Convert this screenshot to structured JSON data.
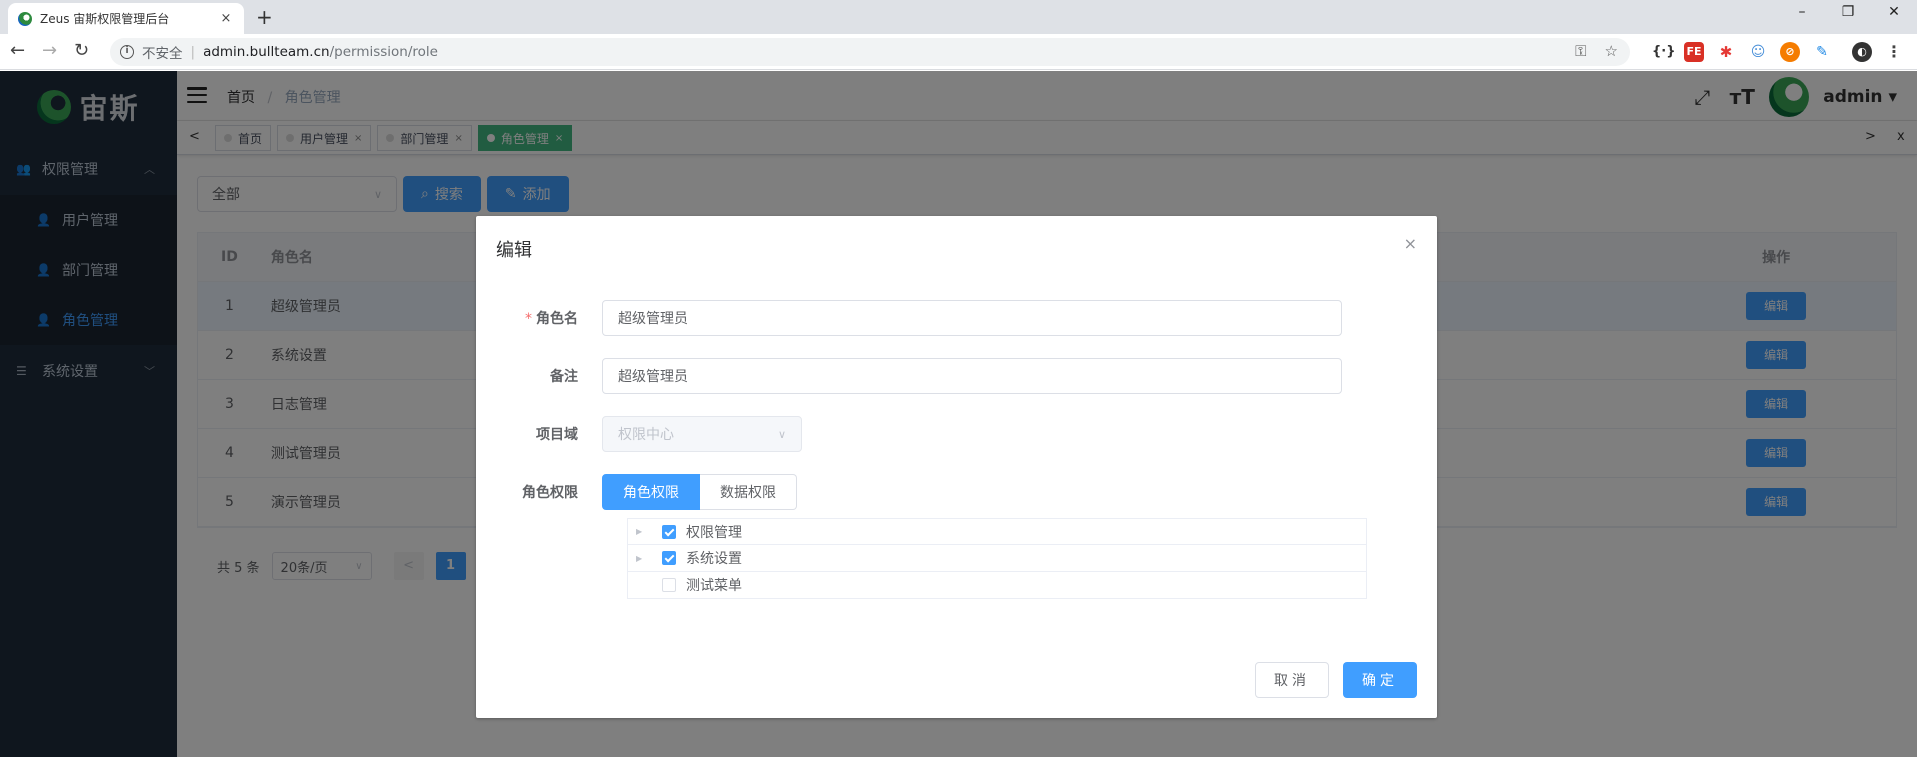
{
  "browser": {
    "tab_title": "Zeus 宙斯权限管理后台",
    "tab_close": "×",
    "new_tab": "+",
    "insecure_label": "不安全",
    "url_host": "admin.bullteam.cn",
    "url_path": "/permission/role",
    "win_min": "–",
    "win_max": "❐",
    "win_close": "✕"
  },
  "sidebar": {
    "logo_text": "宙斯",
    "groups": [
      {
        "label": "权限管理",
        "items": [
          "用户管理",
          "部门管理",
          "角色管理"
        ],
        "active_index": 2
      },
      {
        "label": "系统设置"
      }
    ]
  },
  "header": {
    "breadcrumb": {
      "home": "首页",
      "separator": "/",
      "current": "角色管理"
    },
    "user": "admin ▾"
  },
  "tags_view": {
    "left": "<",
    "right": ">",
    "close_all": "x",
    "tags": [
      {
        "label": "首页",
        "closable": false
      },
      {
        "label": "用户管理",
        "closable": true
      },
      {
        "label": "部门管理",
        "closable": true
      },
      {
        "label": "角色管理",
        "closable": true,
        "active": true
      }
    ],
    "close_glyph": "×"
  },
  "filter": {
    "select_value": "全部",
    "search_label": "搜索",
    "add_label": "添加"
  },
  "table": {
    "headers": {
      "id": "ID",
      "name": "角色名",
      "op": "操作"
    },
    "rows": [
      {
        "id": "1",
        "name": "超级管理员",
        "op": "编辑"
      },
      {
        "id": "2",
        "name": "系统设置",
        "op": "编辑"
      },
      {
        "id": "3",
        "name": "日志管理",
        "op": "编辑"
      },
      {
        "id": "4",
        "name": "测试管理员",
        "op": "编辑"
      },
      {
        "id": "5",
        "name": "演示管理员",
        "op": "编辑"
      }
    ]
  },
  "pagination": {
    "total": "共 5 条",
    "page_size": "20条/页",
    "prev": "<",
    "current_page": "1"
  },
  "dialog": {
    "title": "编辑",
    "close": "×",
    "fields": {
      "role_name_label": "角色名",
      "required_mark": "*",
      "role_name_value": "超级管理员",
      "remark_label": "备注",
      "remark_value": "超级管理员",
      "domain_label": "项目域",
      "domain_value": "权限中心",
      "perm_label": "角色权限"
    },
    "perm_tabs": {
      "role": "角色权限",
      "data": "数据权限"
    },
    "tree": [
      {
        "label": "权限管理",
        "checked": true,
        "expandable": true
      },
      {
        "label": "系统设置",
        "checked": true,
        "expandable": true
      },
      {
        "label": "测试菜单",
        "checked": false,
        "expandable": false
      }
    ],
    "cancel": "取消",
    "confirm": "确定"
  },
  "colors": {
    "primary": "#409eff",
    "sidebar_bg": "#1f2d3d",
    "active_tag": "#42b983"
  }
}
